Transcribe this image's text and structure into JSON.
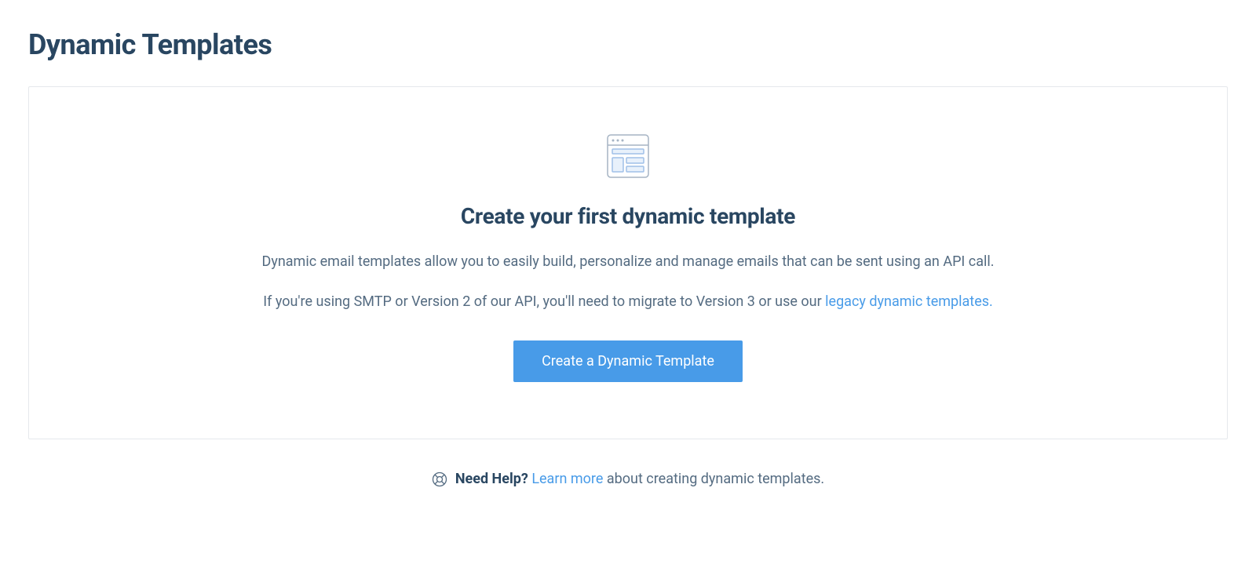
{
  "page": {
    "title": "Dynamic Templates"
  },
  "empty_state": {
    "heading": "Create your first dynamic template",
    "description": "Dynamic email templates allow you to easily build, personalize and manage emails that can be sent using an API call.",
    "migration_prefix": "If you're using SMTP or Version 2 of our API, you'll need to migrate to Version 3 or use our ",
    "legacy_link": "legacy dynamic templates.",
    "cta": "Create a Dynamic Template"
  },
  "help": {
    "label": "Need Help?",
    "link_text": "Learn more",
    "suffix": " about creating dynamic templates."
  },
  "colors": {
    "primary": "#489be8",
    "text_dark": "#294661",
    "text_muted": "#546b81",
    "border": "#e5e8ec"
  }
}
